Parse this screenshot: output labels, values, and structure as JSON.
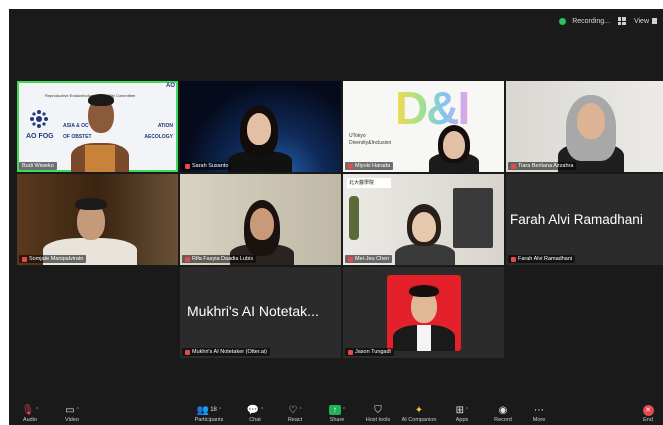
{
  "topbar": {
    "recording": "Recording...",
    "view": "View"
  },
  "tiles": {
    "budi": {
      "name": "Budi Wiweko",
      "slide_header": "Reproductive Endocrinology & Infertility Committee",
      "org_line1": "ASIA & OC",
      "org_line2": "ATION",
      "org_line3": "OF OBSTET",
      "org_line4": "AECOLOGY",
      "logo_text": "AO FOG",
      "corner_logo": "AO"
    },
    "sarah": {
      "name": "Sarah Susanto"
    },
    "miyuki": {
      "name": "Miyuki Harada",
      "brand_line1": "UTokyo",
      "brand_line2": "Diversity&Inclusion",
      "di": "D&I"
    },
    "tiara": {
      "name": "Tiara Berliana Azzahra"
    },
    "somjate": {
      "name": "Somjate Manipalviratn"
    },
    "rifa": {
      "name": "Rifa Fasyia Daadia Lubis"
    },
    "meijeu": {
      "name": "Mei-Jeu Chen",
      "banner": "北大醫學院"
    },
    "farah": {
      "name": "Farah Alvi Ramadhani",
      "display": "Farah Alvi Ramadhani"
    },
    "mukhri": {
      "name": "Mukhri's AI Notetaker (Otter.ai)",
      "display": "Mukhri's AI Notetak..."
    },
    "jason": {
      "name": "Jason Tungadi"
    }
  },
  "toolbar": {
    "audio": "Audio",
    "video": "Video",
    "participants": "Participants",
    "participants_count": "18",
    "chat": "Chat",
    "react": "React",
    "share": "Share",
    "host_tools": "Host tools",
    "ai_companion": "AI Companion",
    "apps": "Apps",
    "record": "Record",
    "more": "More",
    "end": "End"
  },
  "colors": {
    "accent": "#3ddc5a",
    "share": "#21b35a",
    "danger": "#e5484d"
  }
}
